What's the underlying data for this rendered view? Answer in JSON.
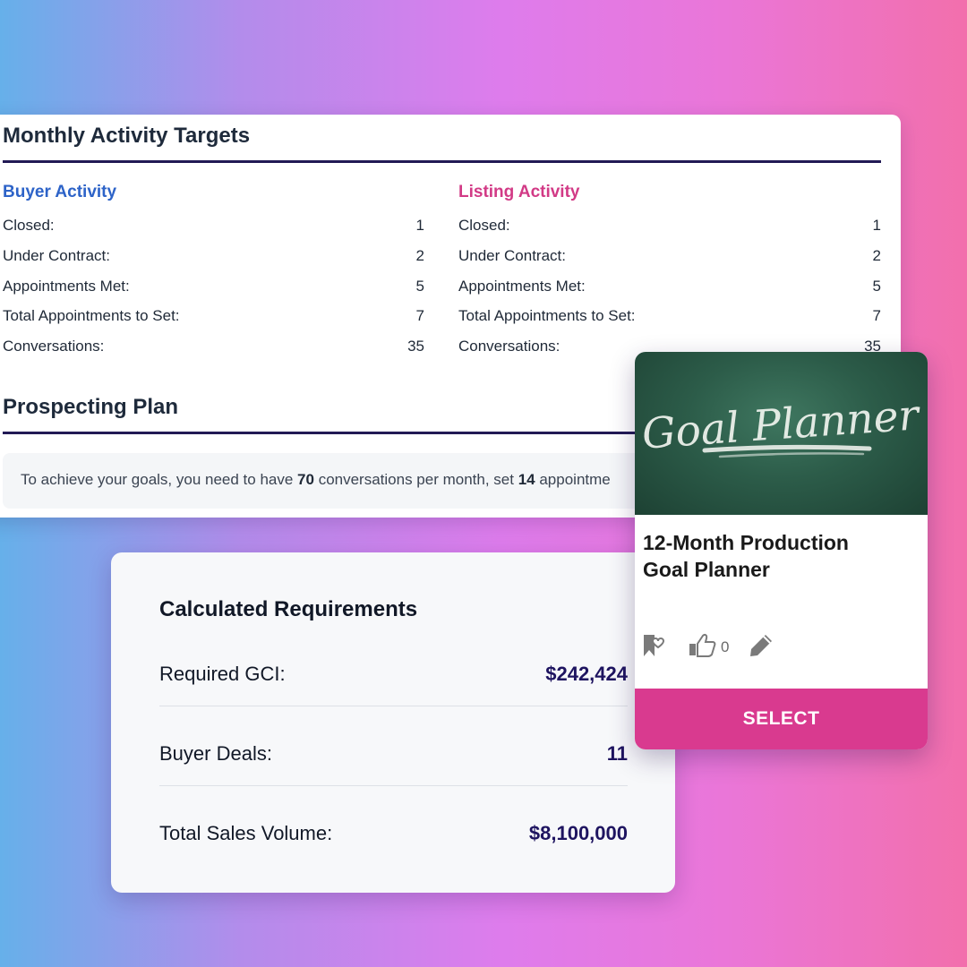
{
  "targets": {
    "title": "Monthly Activity Targets",
    "buyer": {
      "heading": "Buyer Activity",
      "rows": [
        {
          "label": "Closed:",
          "value": "1"
        },
        {
          "label": "Under Contract:",
          "value": "2"
        },
        {
          "label": "Appointments Met:",
          "value": "5"
        },
        {
          "label": "Total Appointments to Set:",
          "value": "7"
        },
        {
          "label": "Conversations:",
          "value": "35"
        }
      ]
    },
    "listing": {
      "heading": "Listing Activity",
      "rows": [
        {
          "label": "Closed:",
          "value": "1"
        },
        {
          "label": "Under Contract:",
          "value": "2"
        },
        {
          "label": "Appointments Met:",
          "value": "5"
        },
        {
          "label": "Total Appointments to Set:",
          "value": "7"
        },
        {
          "label": "Conversations:",
          "value": "35"
        }
      ]
    }
  },
  "prospecting": {
    "title": "Prospecting Plan",
    "text_before": "To achieve your goals, you need to have ",
    "conversations": "70",
    "text_middle": " conversations per month, set ",
    "appointments": "14",
    "text_after": " appointme"
  },
  "calculated": {
    "title": "Calculated Requirements",
    "rows": [
      {
        "label": "Required GCI:",
        "value": "$242,424"
      },
      {
        "label": "Buyer Deals:",
        "value": "11"
      },
      {
        "label": "Total Sales Volume:",
        "value": "$8,100,000"
      }
    ]
  },
  "planner_card": {
    "image_text": "Goal Planner",
    "title_line1": "12-Month Production",
    "title_line2": "Goal Planner",
    "like_count": "0",
    "select_label": "SELECT",
    "icons": [
      "bookmark-heart-icon",
      "thumbs-up-icon",
      "pencil-icon"
    ]
  },
  "colors": {
    "buyer_accent": "#2d63c8",
    "listing_accent": "#d23a86",
    "select_button": "#d93a8f",
    "value_text": "#1e1460"
  }
}
